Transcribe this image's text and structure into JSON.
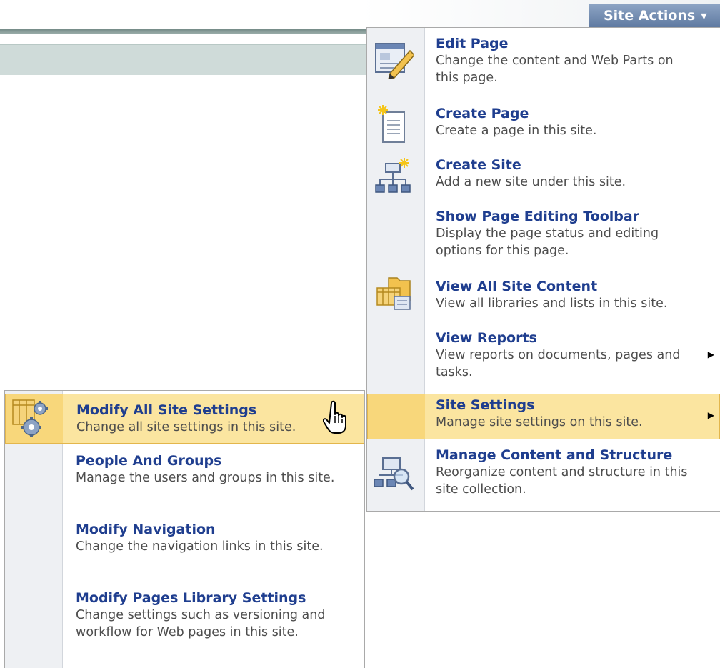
{
  "site_actions": {
    "label": "Site Actions"
  },
  "menu": {
    "items": [
      {
        "title": "Edit Page",
        "desc": "Change the content and Web Parts on this page.",
        "icon": "edit-page-icon"
      },
      {
        "title": "Create Page",
        "desc": "Create a page in this site.",
        "icon": "create-page-icon"
      },
      {
        "title": "Create Site",
        "desc": "Add a new site under this site.",
        "icon": "create-site-icon"
      },
      {
        "title": "Show Page Editing Toolbar",
        "desc": "Display the page status and editing options for this page.",
        "icon": ""
      },
      {
        "title": "View All Site Content",
        "desc": "View all libraries and lists in this site.",
        "icon": "view-all-content-icon"
      },
      {
        "title": "View Reports",
        "desc": "View reports on documents, pages and tasks.",
        "icon": ""
      },
      {
        "title": "Site Settings",
        "desc": "Manage site settings on this site.",
        "icon": ""
      },
      {
        "title": "Manage Content and Structure",
        "desc": "Reorganize content and structure in this site collection.",
        "icon": "manage-content-icon"
      }
    ]
  },
  "submenu": {
    "items": [
      {
        "title": "Modify All Site Settings",
        "desc": "Change all site settings in this site.",
        "icon": "site-settings-gear-icon"
      },
      {
        "title": "People And Groups",
        "desc": "Manage the users and groups in this site."
      },
      {
        "title": "Modify Navigation",
        "desc": "Change the navigation links in this site."
      },
      {
        "title": "Modify Pages Library Settings",
        "desc": "Change settings such as versioning and workflow for Web pages in this site."
      }
    ]
  },
  "colors": {
    "link": "#1f3e8f",
    "highlight": "#fbe5a0",
    "site_actions_bg": "#6f88ad"
  }
}
